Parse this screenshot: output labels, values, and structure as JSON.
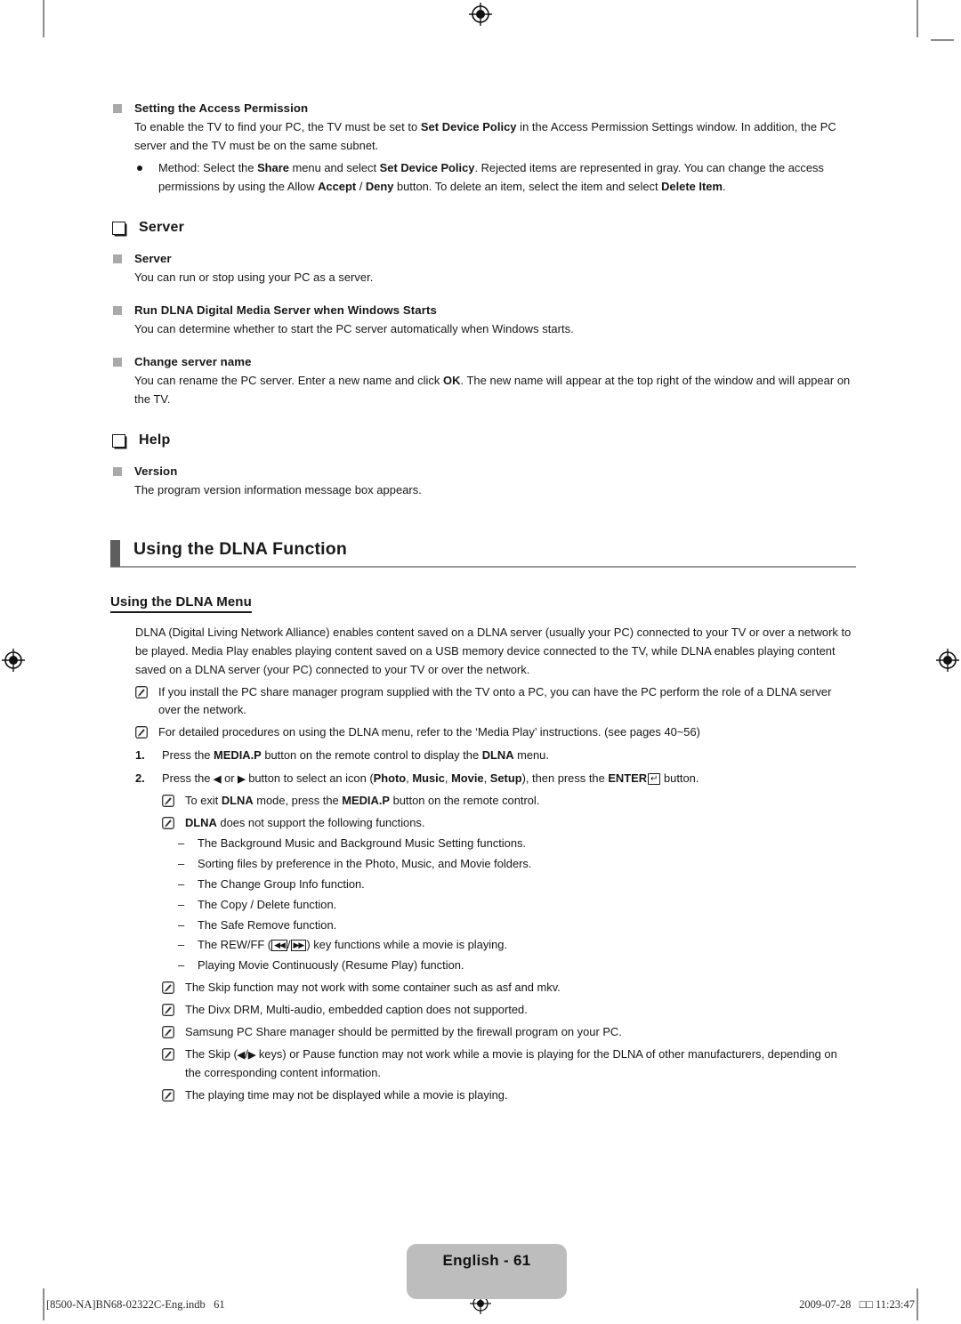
{
  "document": {
    "page_label": "English - 61",
    "footer_left": "[8500-NA]BN68-02322C-Eng.indb   61",
    "footer_right": "2009-07-28   □□ 11:23:47"
  },
  "access_permission": {
    "heading": "Setting the Access Permission",
    "paragraph": "To enable the TV to find your PC, the TV must be set to ",
    "paragraph_b1": "Set Device Policy",
    "paragraph_2": " in the Access Permission Settings window. In addition, the PC server and the TV must be on the same subnet.",
    "bullet_1a": "Method: Select the ",
    "bullet_1b": "Share",
    "bullet_1c": " menu and select ",
    "bullet_1d": "Set Device Policy",
    "bullet_1e": ". Rejected items are represented in gray. You can change the access permissions by using the Allow ",
    "bullet_1f": "Accept",
    "bullet_1g": " / ",
    "bullet_1h": "Deny",
    "bullet_1i": " button. To delete an item, select the item and select ",
    "bullet_1j": "Delete Item",
    "bullet_1k": "."
  },
  "server_section": {
    "title": "Server",
    "items": [
      {
        "heading": "Server",
        "body": "You can run or stop using your PC as a server."
      },
      {
        "heading": "Run DLNA Digital Media Server when Windows Starts",
        "body": "You can determine whether to start the PC server automatically when Windows starts."
      },
      {
        "heading": "Change server name",
        "body_a": "You can rename the PC server. Enter a new name and click ",
        "body_b": "OK",
        "body_c": ". The new name will appear at the top right of the window and will appear on the TV."
      }
    ]
  },
  "help_section": {
    "title": "Help",
    "items": [
      {
        "heading": "Version",
        "body": "The program version information message box appears."
      }
    ]
  },
  "dlna_chapter": {
    "title": "Using the DLNA Function",
    "subheading": "Using the DLNA Menu",
    "intro": "DLNA (Digital Living Network Alliance) enables content saved on a DLNA server (usually your PC) connected to your TV or over a network to be played. Media Play enables playing content saved on a USB memory device connected to the TV, while DLNA enables playing content saved on a DLNA server (your PC) connected to your TV or over the network.",
    "intro_notes": [
      "If you install the PC share manager program supplied with the TV onto a PC, you can have the PC perform the role of a DLNA server over the network.",
      "For detailed procedures on using the DLNA menu, refer to the ‘Media Play’ instructions. (see pages 40~56)"
    ],
    "steps": [
      {
        "number": "1.",
        "text_a": "Press the ",
        "text_b": "MEDIA.P",
        "text_c": " button on the remote control to display the ",
        "text_d": "DLNA",
        "text_e": " menu."
      },
      {
        "number": "2.",
        "text_a": "Press the ",
        "text_b": "◀",
        "text_c": " or ",
        "text_d": "▶",
        "text_e": " button to select an icon (",
        "text_f": "Photo",
        "text_g": ", ",
        "text_h": "Music",
        "text_i": ", ",
        "text_j": "Movie",
        "text_k": ", ",
        "text_l": "Setup",
        "text_m": "), then press the ",
        "text_n": "ENTER",
        "text_o": " button."
      }
    ],
    "step_notes": [
      {
        "text_a": "To exit ",
        "text_b": "DLNA",
        "text_c": " mode, press the ",
        "text_d": "MEDIA.P",
        "text_e": " button on the remote control."
      },
      {
        "text_a": "",
        "text_b": "DLNA",
        "text_c": " does not support the following functions.",
        "text_d": "",
        "text_e": ""
      }
    ],
    "unsupported": [
      "The Background Music and Background Music Setting functions.",
      "Sorting files by preference in the Photo, Music, and Movie folders.",
      "The Change Group Info function.",
      "The Copy / Delete function.",
      "The Safe Remove function.",
      "Playing Movie Continuously (Resume Play) function."
    ],
    "rewff_note": {
      "prefix": "The REW/FF (",
      "rew": "◀◀",
      "sep": "/",
      "ff": "▶▶",
      "suffix": ") key functions while a movie is playing."
    },
    "final_notes": [
      "The Skip function may not work with some container such as asf and mkv.",
      "The Divx DRM, Multi-audio, embedded caption does not supported.",
      "Samsung PC Share manager should be permitted by the firewall program on your PC.",
      "The playing time may not be displayed while a movie is playing."
    ],
    "skip_note": {
      "prefix": "The Skip (",
      "left": "◀",
      "sep": "/",
      "right": "▶",
      "suffix": " keys) or Pause function may not work while a movie is playing for the DLNA of other manufacturers, depending on the corresponding content information."
    }
  },
  "colors": {
    "bullet_gray": "#a9a9a9",
    "chapter_bar": "#5e5e5e",
    "rule_gray": "#9a9a9a",
    "badge_gray": "#bdbdbd",
    "crop_gray": "#8c8c8c"
  }
}
